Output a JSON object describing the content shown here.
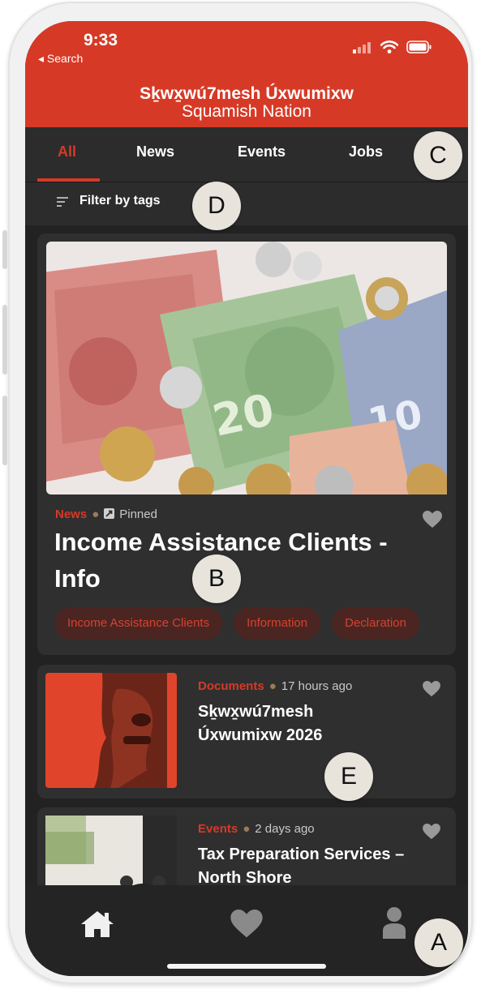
{
  "status_bar": {
    "time": "9:33",
    "back_label": "◂ Search"
  },
  "header": {
    "brand_line1": "Sḵwx̱wú7mesh Úxwumixw",
    "brand_line2": "Squamish Nation"
  },
  "tabs": [
    {
      "label": "All",
      "active": true
    },
    {
      "label": "News"
    },
    {
      "label": "Events"
    },
    {
      "label": "Jobs"
    }
  ],
  "filter": {
    "label": "Filter by tags"
  },
  "featured": {
    "category": "News",
    "pinned_label": "Pinned",
    "title": "Income Assistance Clients - Info",
    "tags": [
      "Income Assistance Clients",
      "Information",
      "Declaration"
    ]
  },
  "list": [
    {
      "category": "Documents",
      "time": "17 hours ago",
      "title": "Sḵwx̱wú7mesh Úxwumixw 2026"
    },
    {
      "category": "Events",
      "time": "2 days ago",
      "title": "Tax Preparation Services – North Shore"
    }
  ],
  "callouts": {
    "a": "A",
    "b": "B",
    "c": "C",
    "d": "D",
    "e": "E"
  },
  "colors": {
    "accent": "#d63a26",
    "background": "#2c2c2c",
    "card": "#2f2f2f",
    "tag_bg": "#4a2522"
  },
  "icons": [
    "home-icon",
    "heart-icon",
    "profile-icon",
    "filter-icon",
    "pin-icon",
    "wifi-icon",
    "battery-icon",
    "signal-icon"
  ]
}
